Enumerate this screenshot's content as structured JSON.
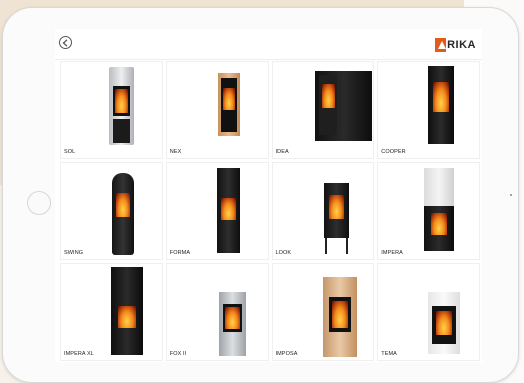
{
  "header": {
    "back_icon": "back-arrow-circle-icon",
    "logo_text": "RIKA",
    "logo_color": "#e35a19"
  },
  "products": [
    {
      "name": "SOL"
    },
    {
      "name": "NEX"
    },
    {
      "name": "IDEA"
    },
    {
      "name": "COOPER"
    },
    {
      "name": "SWING"
    },
    {
      "name": "FORMA"
    },
    {
      "name": "LOOK"
    },
    {
      "name": "IMPERA"
    },
    {
      "name": "IMPERA XL"
    },
    {
      "name": "FOX II"
    },
    {
      "name": "IMPOSA"
    },
    {
      "name": "TEMA"
    }
  ]
}
